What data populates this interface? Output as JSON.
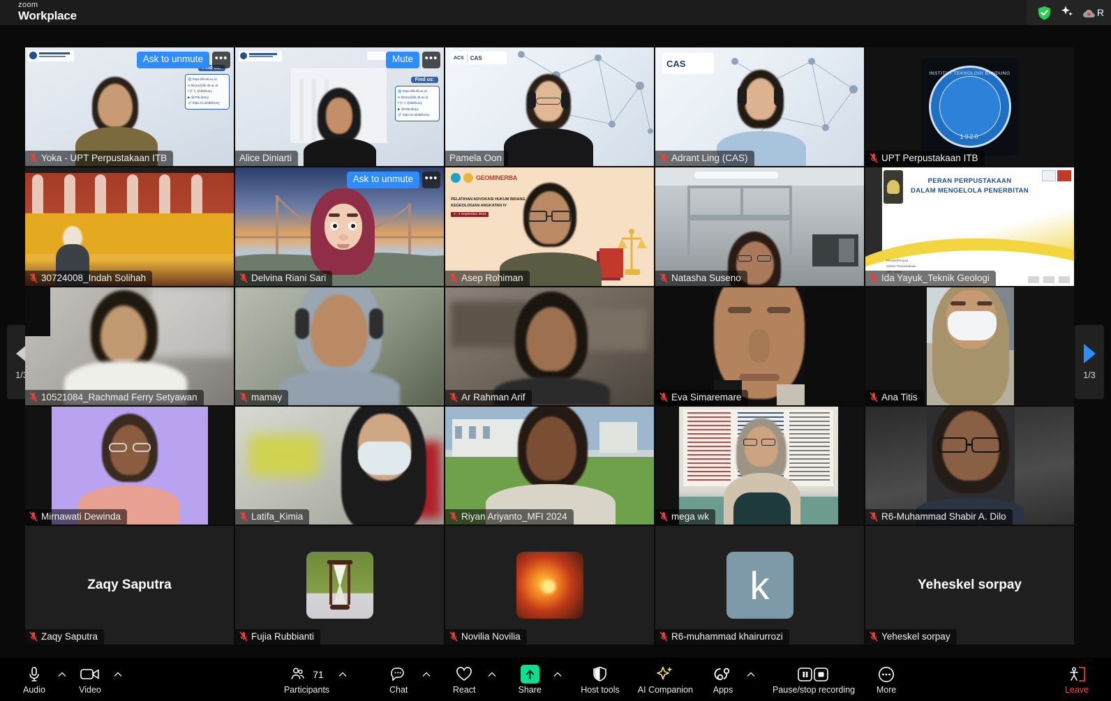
{
  "titlebar": {
    "brand_small": "zoom",
    "brand_main": "Workplace",
    "encryption_icon": "green-shield-check-icon",
    "ai_icon": "sparkle-icon",
    "recording_label": "R"
  },
  "pagination": {
    "left_label": "1/3",
    "right_label": "1/3",
    "left_icon": "chevron-left-icon",
    "right_icon": "chevron-right-icon"
  },
  "controls": {
    "ask_to_unmute": "Ask to unmute",
    "mute": "Mute",
    "more_dots": "•••"
  },
  "gallery": {
    "rows": [
      [
        {
          "name": "Yoka - UPT Perpustakaan ITB",
          "muted": true,
          "action": "Ask to unmute",
          "active": false,
          "art": "library-slide",
          "findus": "Find us:"
        },
        {
          "name": "Alice Diniarti",
          "muted": false,
          "action": "Mute",
          "active": true,
          "art": "library-slide-2",
          "findus": "Find us:"
        },
        {
          "name": "Pamela Oon",
          "muted": false,
          "action": null,
          "active": false,
          "art": "cas-network"
        },
        {
          "name": "Adrant Ling (CAS)",
          "muted": true,
          "action": null,
          "active": false,
          "art": "cas-network"
        },
        {
          "name": "UPT Perpustakaan ITB",
          "muted": true,
          "action": null,
          "active": false,
          "art": "itb-logo"
        }
      ],
      [
        {
          "name": "30724008_Indah Solihah",
          "muted": true,
          "action": null,
          "active": false,
          "art": "red-building"
        },
        {
          "name": "Delvina Riani Sari",
          "muted": true,
          "action": "Ask to unmute",
          "active": false,
          "art": "bridge-avatar"
        },
        {
          "name": "Asep Rohiman",
          "muted": true,
          "action": null,
          "active": false,
          "art": "geominerba"
        },
        {
          "name": "Natasha Suseno",
          "muted": true,
          "action": null,
          "active": false,
          "art": "warehouse"
        },
        {
          "name": "Ida Yayuk_Teknik Geologi",
          "muted": true,
          "action": null,
          "active": false,
          "art": "presentation-slide"
        }
      ],
      [
        {
          "name": "10521084_Rachmad Ferry Setyawan",
          "muted": true,
          "action": null,
          "active": false,
          "art": "blur-room"
        },
        {
          "name": "mamay",
          "muted": true,
          "action": null,
          "active": false,
          "art": "blur-room-2"
        },
        {
          "name": "Ar Rahman Arif",
          "muted": true,
          "action": null,
          "active": false,
          "art": "blur-shelf"
        },
        {
          "name": "Eva Simaremare",
          "muted": true,
          "action": null,
          "active": false,
          "art": "closeup-dark"
        },
        {
          "name": "Ana Titis",
          "muted": true,
          "action": null,
          "active": false,
          "art": "mask-portrait"
        }
      ],
      [
        {
          "name": "Mirnawati Dewinda",
          "muted": true,
          "action": null,
          "active": false,
          "art": "purple-bg"
        },
        {
          "name": "Latifa_Kimia",
          "muted": true,
          "action": null,
          "active": false,
          "art": "mask-blur"
        },
        {
          "name": "Riyan Ariyanto_MFI 2024",
          "muted": true,
          "action": null,
          "active": false,
          "art": "campus-bg"
        },
        {
          "name": "mega wk",
          "muted": true,
          "action": null,
          "active": false,
          "art": "whiteboard"
        },
        {
          "name": "R6-Muhammad Shabir A. Dilo",
          "muted": true,
          "action": null,
          "active": false,
          "art": "dark-room"
        }
      ],
      [
        {
          "name": "Zaqy Saputra",
          "muted": true,
          "action": null,
          "active": false,
          "art": "name-only",
          "display_name": "Zaqy Saputra"
        },
        {
          "name": "Fujia Rubbianti",
          "muted": true,
          "action": null,
          "active": false,
          "art": "photo-hourglass"
        },
        {
          "name": "Novilia Novilia",
          "muted": true,
          "action": null,
          "active": false,
          "art": "photo-flower"
        },
        {
          "name": "R6-muhammad khairurrozi",
          "muted": true,
          "action": null,
          "active": false,
          "art": "letter-avatar",
          "letter": "k"
        },
        {
          "name": "Yeheskel sorpay",
          "muted": true,
          "action": null,
          "active": false,
          "art": "name-only",
          "display_name": "Yeheskel sorpay"
        }
      ]
    ]
  },
  "toolbar": {
    "audio": {
      "label": "Audio",
      "icon": "microphone-icon",
      "has_caret": true
    },
    "video": {
      "label": "Video",
      "icon": "camera-icon",
      "has_caret": true
    },
    "participants": {
      "label": "Participants",
      "icon": "people-icon",
      "count": "71",
      "has_caret": true
    },
    "chat": {
      "label": "Chat",
      "icon": "chat-bubble-icon",
      "has_caret": true
    },
    "react": {
      "label": "React",
      "icon": "heart-icon",
      "has_caret": true
    },
    "share": {
      "label": "Share",
      "icon": "share-arrow-up-icon",
      "has_caret": true
    },
    "host_tools": {
      "label": "Host tools",
      "icon": "shield-icon",
      "has_caret": false
    },
    "ai_companion": {
      "label": "AI Companion",
      "icon": "sparkle-icon",
      "has_caret": false
    },
    "apps": {
      "label": "Apps",
      "icon": "apps-icon",
      "has_caret": true
    },
    "recording": {
      "label": "Pause/stop recording",
      "icon": "pause-stop-recording-icon",
      "has_caret": false
    },
    "more": {
      "label": "More",
      "icon": "ellipsis-icon",
      "has_caret": false
    },
    "leave": {
      "label": "Leave",
      "icon": "leave-door-icon",
      "has_caret": false
    }
  },
  "colors": {
    "accent_blue": "#2d8cff",
    "active_speaker_green": "#32d74b",
    "share_green": "#0ddf8e",
    "leave_red": "#f24b4b",
    "ai_yellow": "#f4e06a",
    "mute_red": "#e8413a"
  }
}
